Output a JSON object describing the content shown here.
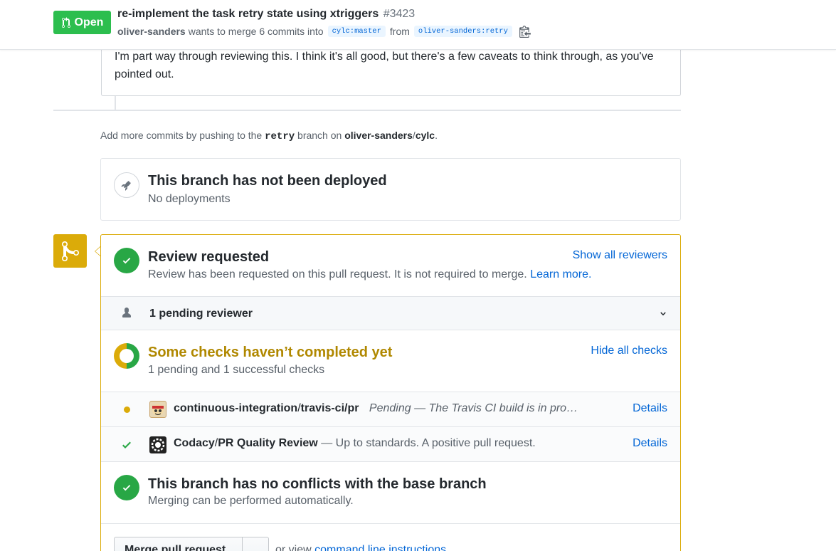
{
  "header": {
    "state_label": "Open",
    "title": "re-implement the task retry state using xtriggers",
    "number": "#3423",
    "author": "oliver-sanders",
    "merge_text": "wants to merge 6 commits into",
    "base_branch": "cylc:master",
    "from_text": "from",
    "head_branch": "oliver-sanders:retry"
  },
  "comment": {
    "text": "I'm part way through reviewing this. I think it's all good, but there's a few caveats to think through, as you've pointed out."
  },
  "push_hint": {
    "prefix": "Add more commits by pushing to the",
    "branch": "retry",
    "middle": "branch on",
    "owner": "oliver-sanders",
    "slash": "/",
    "repo": "cylc",
    "suffix": "."
  },
  "deploy": {
    "title": "This branch has not been deployed",
    "subtitle": "No deployments"
  },
  "merge": {
    "accent": "#dbab09",
    "review": {
      "title": "Review requested",
      "subtitle": "Review has been requested on this pull request. It is not required to merge.",
      "learn_more": "Learn more.",
      "show_all": "Show all reviewers"
    },
    "pending_reviewers": "1 pending reviewer",
    "checks": {
      "title": "Some checks haven’t completed yet",
      "subtitle": "1 pending and 1 successful checks",
      "hide_all": "Hide all checks",
      "items": [
        {
          "context": "continuous-integration",
          "separator": "/",
          "name": "travis-ci/pr",
          "description": "Pending — The Travis CI build is in pro…",
          "details": "Details",
          "status": "pending"
        },
        {
          "context": "Codacy",
          "separator": "/",
          "name": "PR Quality Review",
          "description": "— Up to standards. A positive pull request.",
          "details": "Details",
          "status": "success"
        }
      ]
    },
    "conflicts": {
      "title": "This branch has no conflicts with the base branch",
      "subtitle": "Merging can be performed automatically."
    },
    "merge_button": "Merge pull request",
    "cli_prefix": "or view",
    "cli_link": "command line instructions",
    "cli_suffix": "."
  }
}
